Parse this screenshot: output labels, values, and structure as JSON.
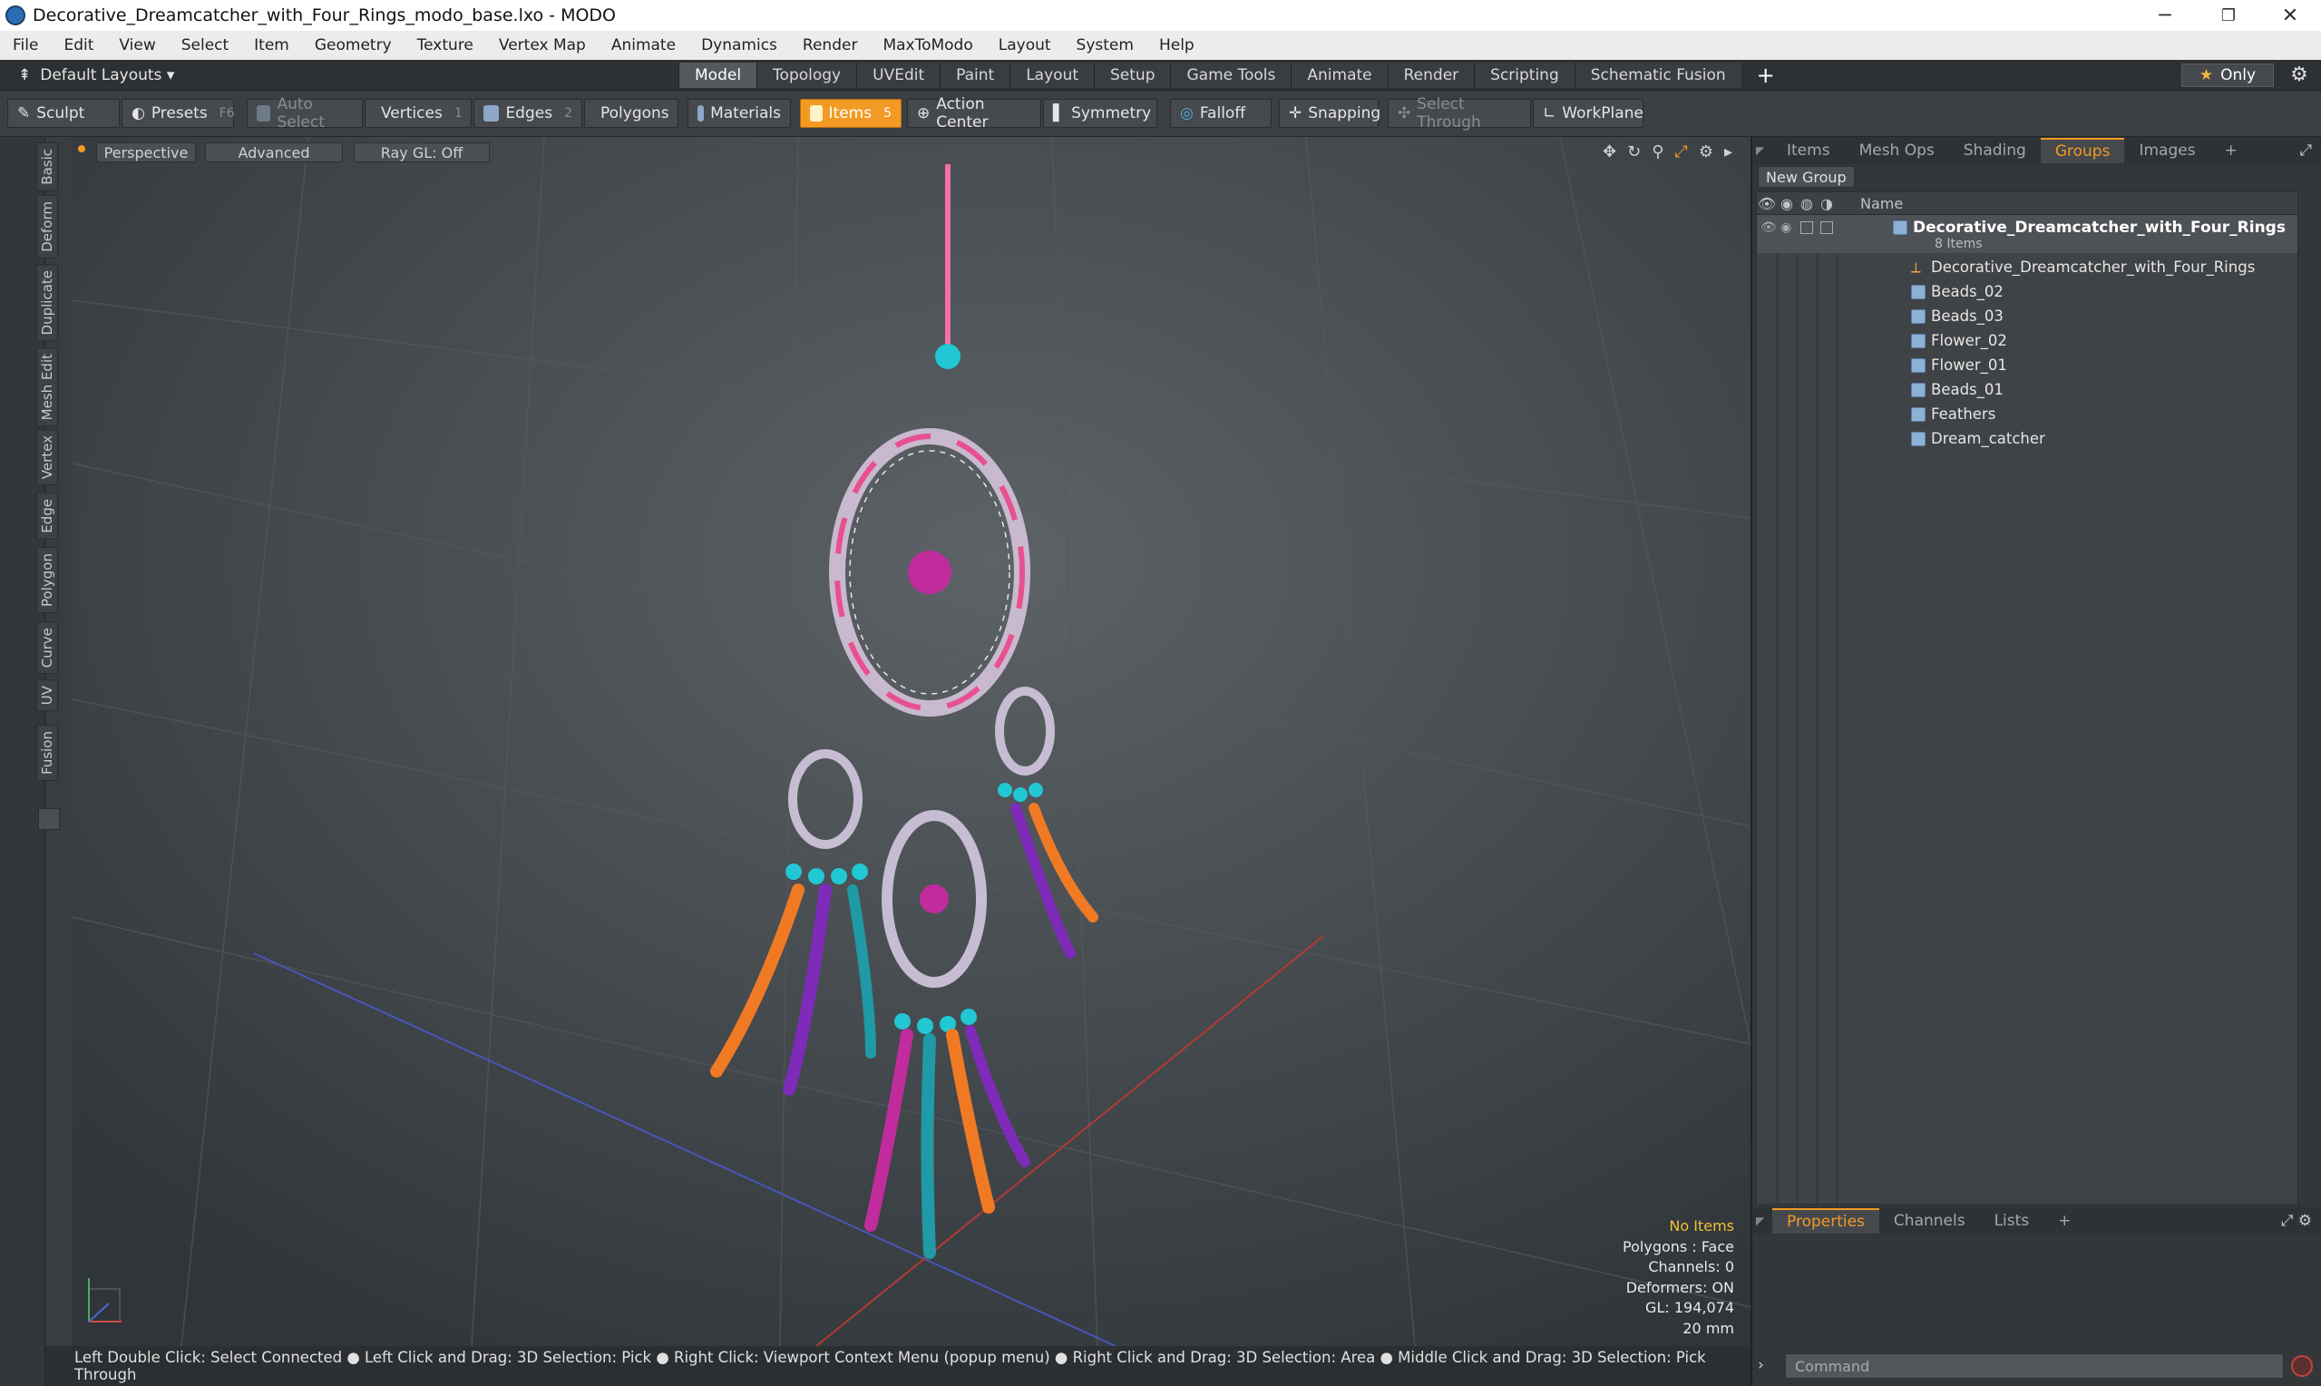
{
  "window": {
    "title": "Decorative_Dreamcatcher_with_Four_Rings_modo_base.lxo - MODO",
    "minimize": "─",
    "restore": "❐",
    "close": "✕"
  },
  "menu": [
    "File",
    "Edit",
    "View",
    "Select",
    "Item",
    "Geometry",
    "Texture",
    "Vertex Map",
    "Animate",
    "Dynamics",
    "Render",
    "MaxToModo",
    "Layout",
    "System",
    "Help"
  ],
  "layoutbar": {
    "layouts": "Default Layouts ▾",
    "tabs": [
      "Model",
      "Topology",
      "UVEdit",
      "Paint",
      "Layout",
      "Setup",
      "Game Tools",
      "Animate",
      "Render",
      "Scripting",
      "Schematic Fusion"
    ],
    "active_tab": "Model",
    "plus": "+",
    "only": "Only"
  },
  "toolbar": {
    "sculpt": "Sculpt",
    "presets": "Presets",
    "presets_key": "F6",
    "auto_select": "Auto Select",
    "vertices": "Vertices",
    "vertices_count": "1",
    "edges": "Edges",
    "edges_count": "2",
    "polygons": "Polygons",
    "materials": "Materials",
    "items": "Items",
    "items_count": "5",
    "action_center": "Action Center",
    "symmetry": "Symmetry",
    "falloff": "Falloff",
    "snapping": "Snapping",
    "select_through": "Select Through",
    "workplane": "WorkPlane"
  },
  "left_tabs": [
    "Basic",
    "Deform",
    "Duplicate",
    "Mesh Edit",
    "Vertex",
    "Edge",
    "Polygon",
    "Curve",
    "UV",
    "Fusion"
  ],
  "viewport": {
    "view": "Perspective",
    "shading": "Advanced",
    "raygl": "Ray GL: Off",
    "stats": {
      "selection": "No Items",
      "polygons": "Polygons : Face",
      "channels": "Channels: 0",
      "deformers": "Deformers: ON",
      "gl": "GL: 194,074",
      "scale": "20 mm"
    }
  },
  "statusbar": "Left Double Click: Select Connected ● Left Click and Drag: 3D Selection: Pick ● Right Click: Viewport Context Menu (popup menu) ● Right Click and Drag: 3D Selection: Area ● Middle Click and Drag: 3D Selection: Pick Through",
  "right_panel": {
    "tabs": [
      "Items",
      "Mesh Ops",
      "Shading",
      "Groups",
      "Images"
    ],
    "active_tab": "Groups",
    "plus": "+",
    "new_group": "New Group",
    "name_col": "Name",
    "group": {
      "name": "Decorative_Dreamcatcher_with_Four_Rings",
      "count": "8 Items"
    },
    "items": [
      "Decorative_Dreamcatcher_with_Four_Rings",
      "Beads_02",
      "Beads_03",
      "Flower_02",
      "Flower_01",
      "Beads_01",
      "Feathers",
      "Dream_catcher"
    ]
  },
  "properties": {
    "tabs": [
      "Properties",
      "Channels",
      "Lists"
    ],
    "active_tab": "Properties",
    "plus": "+",
    "command_placeholder": "Command"
  },
  "colors": {
    "accent": "#f29a24",
    "viewport_bg": "#3f4448"
  }
}
